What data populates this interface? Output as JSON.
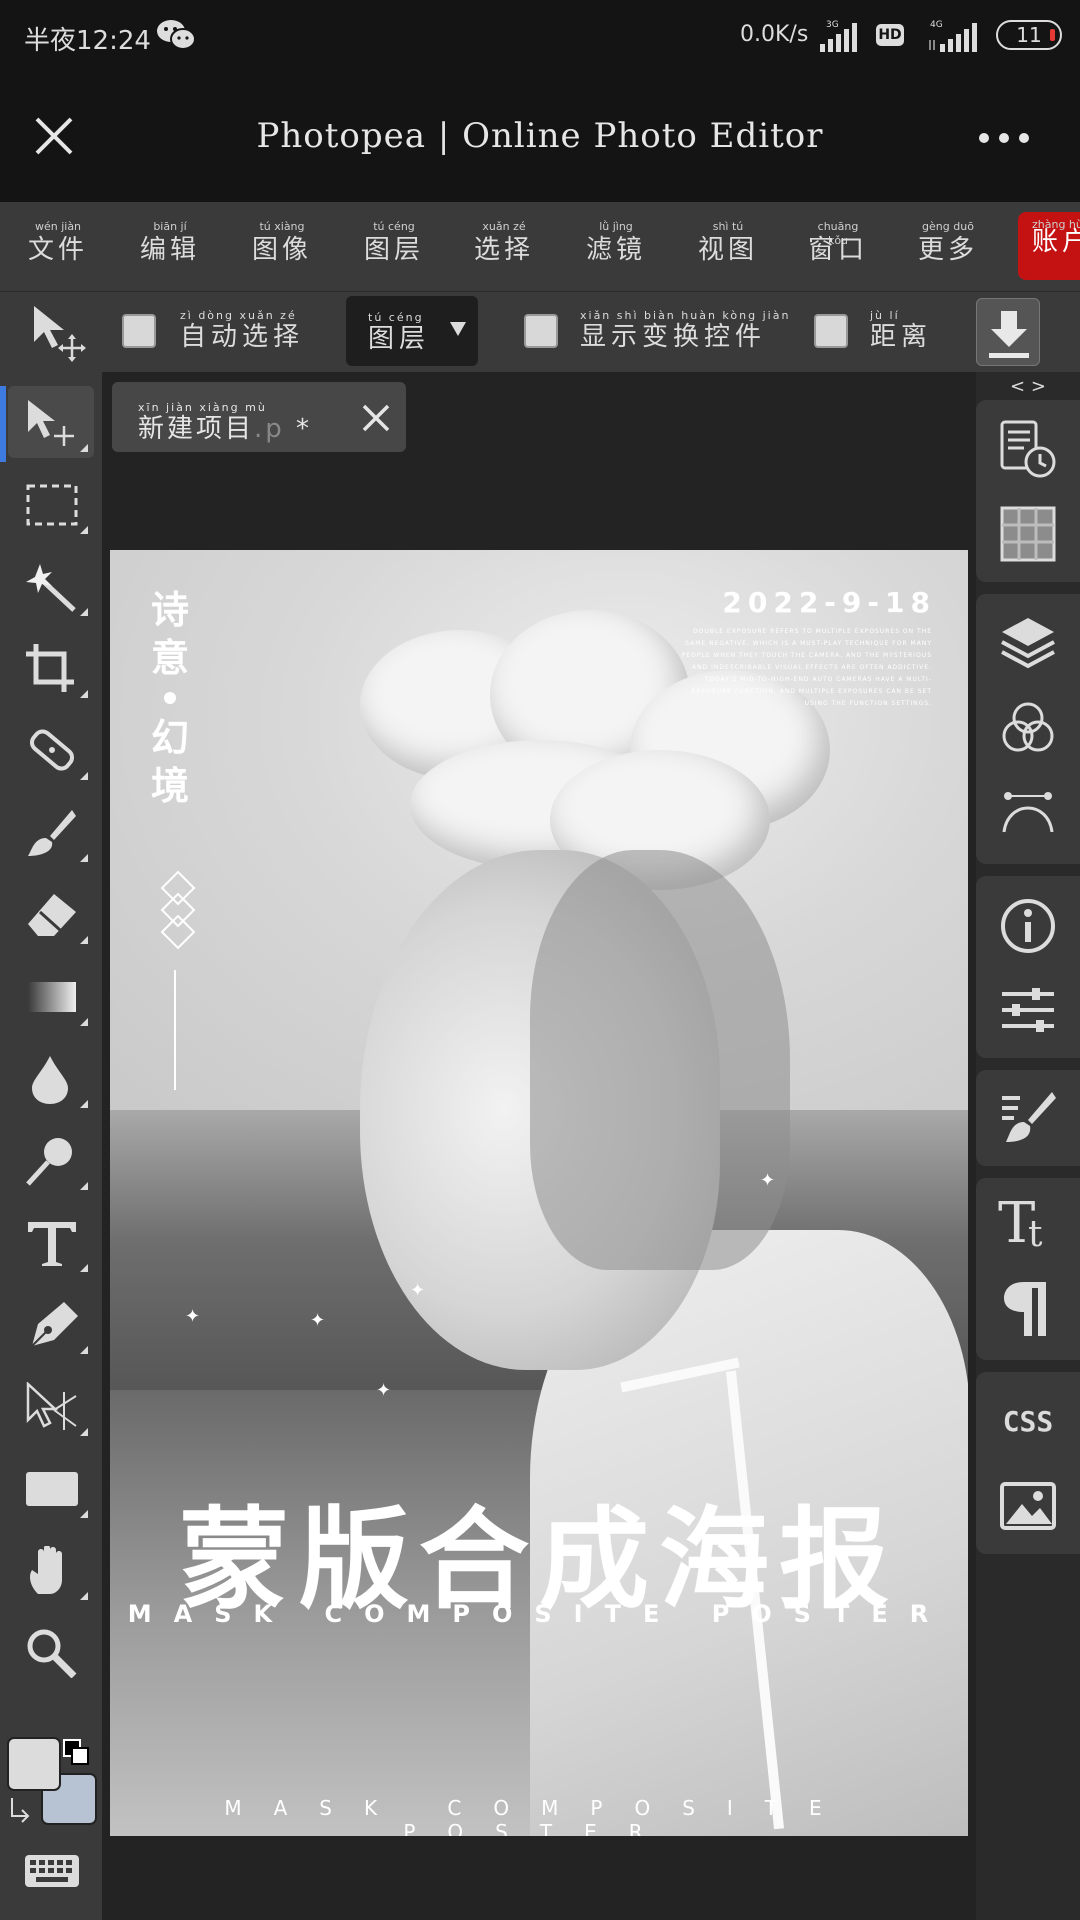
{
  "status_bar": {
    "time": "半夜12:24",
    "net_speed": "0.0K/s",
    "net1": "3G",
    "net2": "4G",
    "hd": "HD",
    "battery": "11"
  },
  "app_bar": {
    "title": "Photopea | Online Photo Editor"
  },
  "menu": {
    "items": [
      {
        "pinyin": "wén jiàn",
        "label": "文件"
      },
      {
        "pinyin": "biān jí",
        "label": "编辑"
      },
      {
        "pinyin": "tú xiàng",
        "label": "图像"
      },
      {
        "pinyin": "tú céng",
        "label": "图层"
      },
      {
        "pinyin": "xuǎn zé",
        "label": "选择"
      },
      {
        "pinyin": "lǜ jìng",
        "label": "滤镜"
      },
      {
        "pinyin": "shì tú",
        "label": "视图"
      },
      {
        "pinyin": "chuāng kǒu",
        "label": "窗口"
      },
      {
        "pinyin": "gèng duō",
        "label": "更多"
      }
    ],
    "account": {
      "pinyin": "zhàng hù",
      "label": "账户"
    }
  },
  "options_bar": {
    "auto_select": {
      "pinyin": "zì dòng xuǎn zé",
      "label": "自动选择"
    },
    "layer_dropdown": {
      "pinyin": "tú céng",
      "label": "图层"
    },
    "show_transform": {
      "pinyin": "xiǎn shì biàn huàn kòng jiàn",
      "label": "显示变换控件"
    },
    "distance": {
      "pinyin": "jù lí",
      "label": "距离"
    }
  },
  "document_tab": {
    "pinyin": "xīn jiàn xiàng mù",
    "name": "新建项目",
    "ext": ".p",
    "modified": " *"
  },
  "right_panel": {
    "collapse_label": "< >",
    "css_label": "CSS"
  },
  "poster": {
    "vertical_title_top": "诗意",
    "vertical_title_bottom": "幻境",
    "date": "2022-9-18",
    "paragraph": "DOUBLE EXPOSURE REFERS TO MULTIPLE EXPOSURES ON THE SAME NEGATIVE, WHICH IS A MUST-PLAY TECHNIQUE FOR MANY PEOPLE WHEN THEY TOUCH THE CAMERA, AND THE MYSTERIOUS AND INDESCRIBABLE VISUAL EFFECTS ARE OFTEN ADDICTIVE. TODAY'S MID-TO-HIGH-END AUTO CAMERAS HAVE A MULTI-EXPOSURE FUNCTION, AND MULTIPLE EXPOSURES CAN BE SET USING THE FUNCTION SETTINGS.",
    "main_title": "蒙版合成海报",
    "subtitle": "MASK COMPOSITE POSTER",
    "footer_text": "MASK COMPOSITE POSTER"
  },
  "colors": {
    "accent_blue": "#3d7be0",
    "account_red": "#c41212",
    "panel_bg": "#3a3a3a",
    "workspace_bg": "#232323"
  }
}
